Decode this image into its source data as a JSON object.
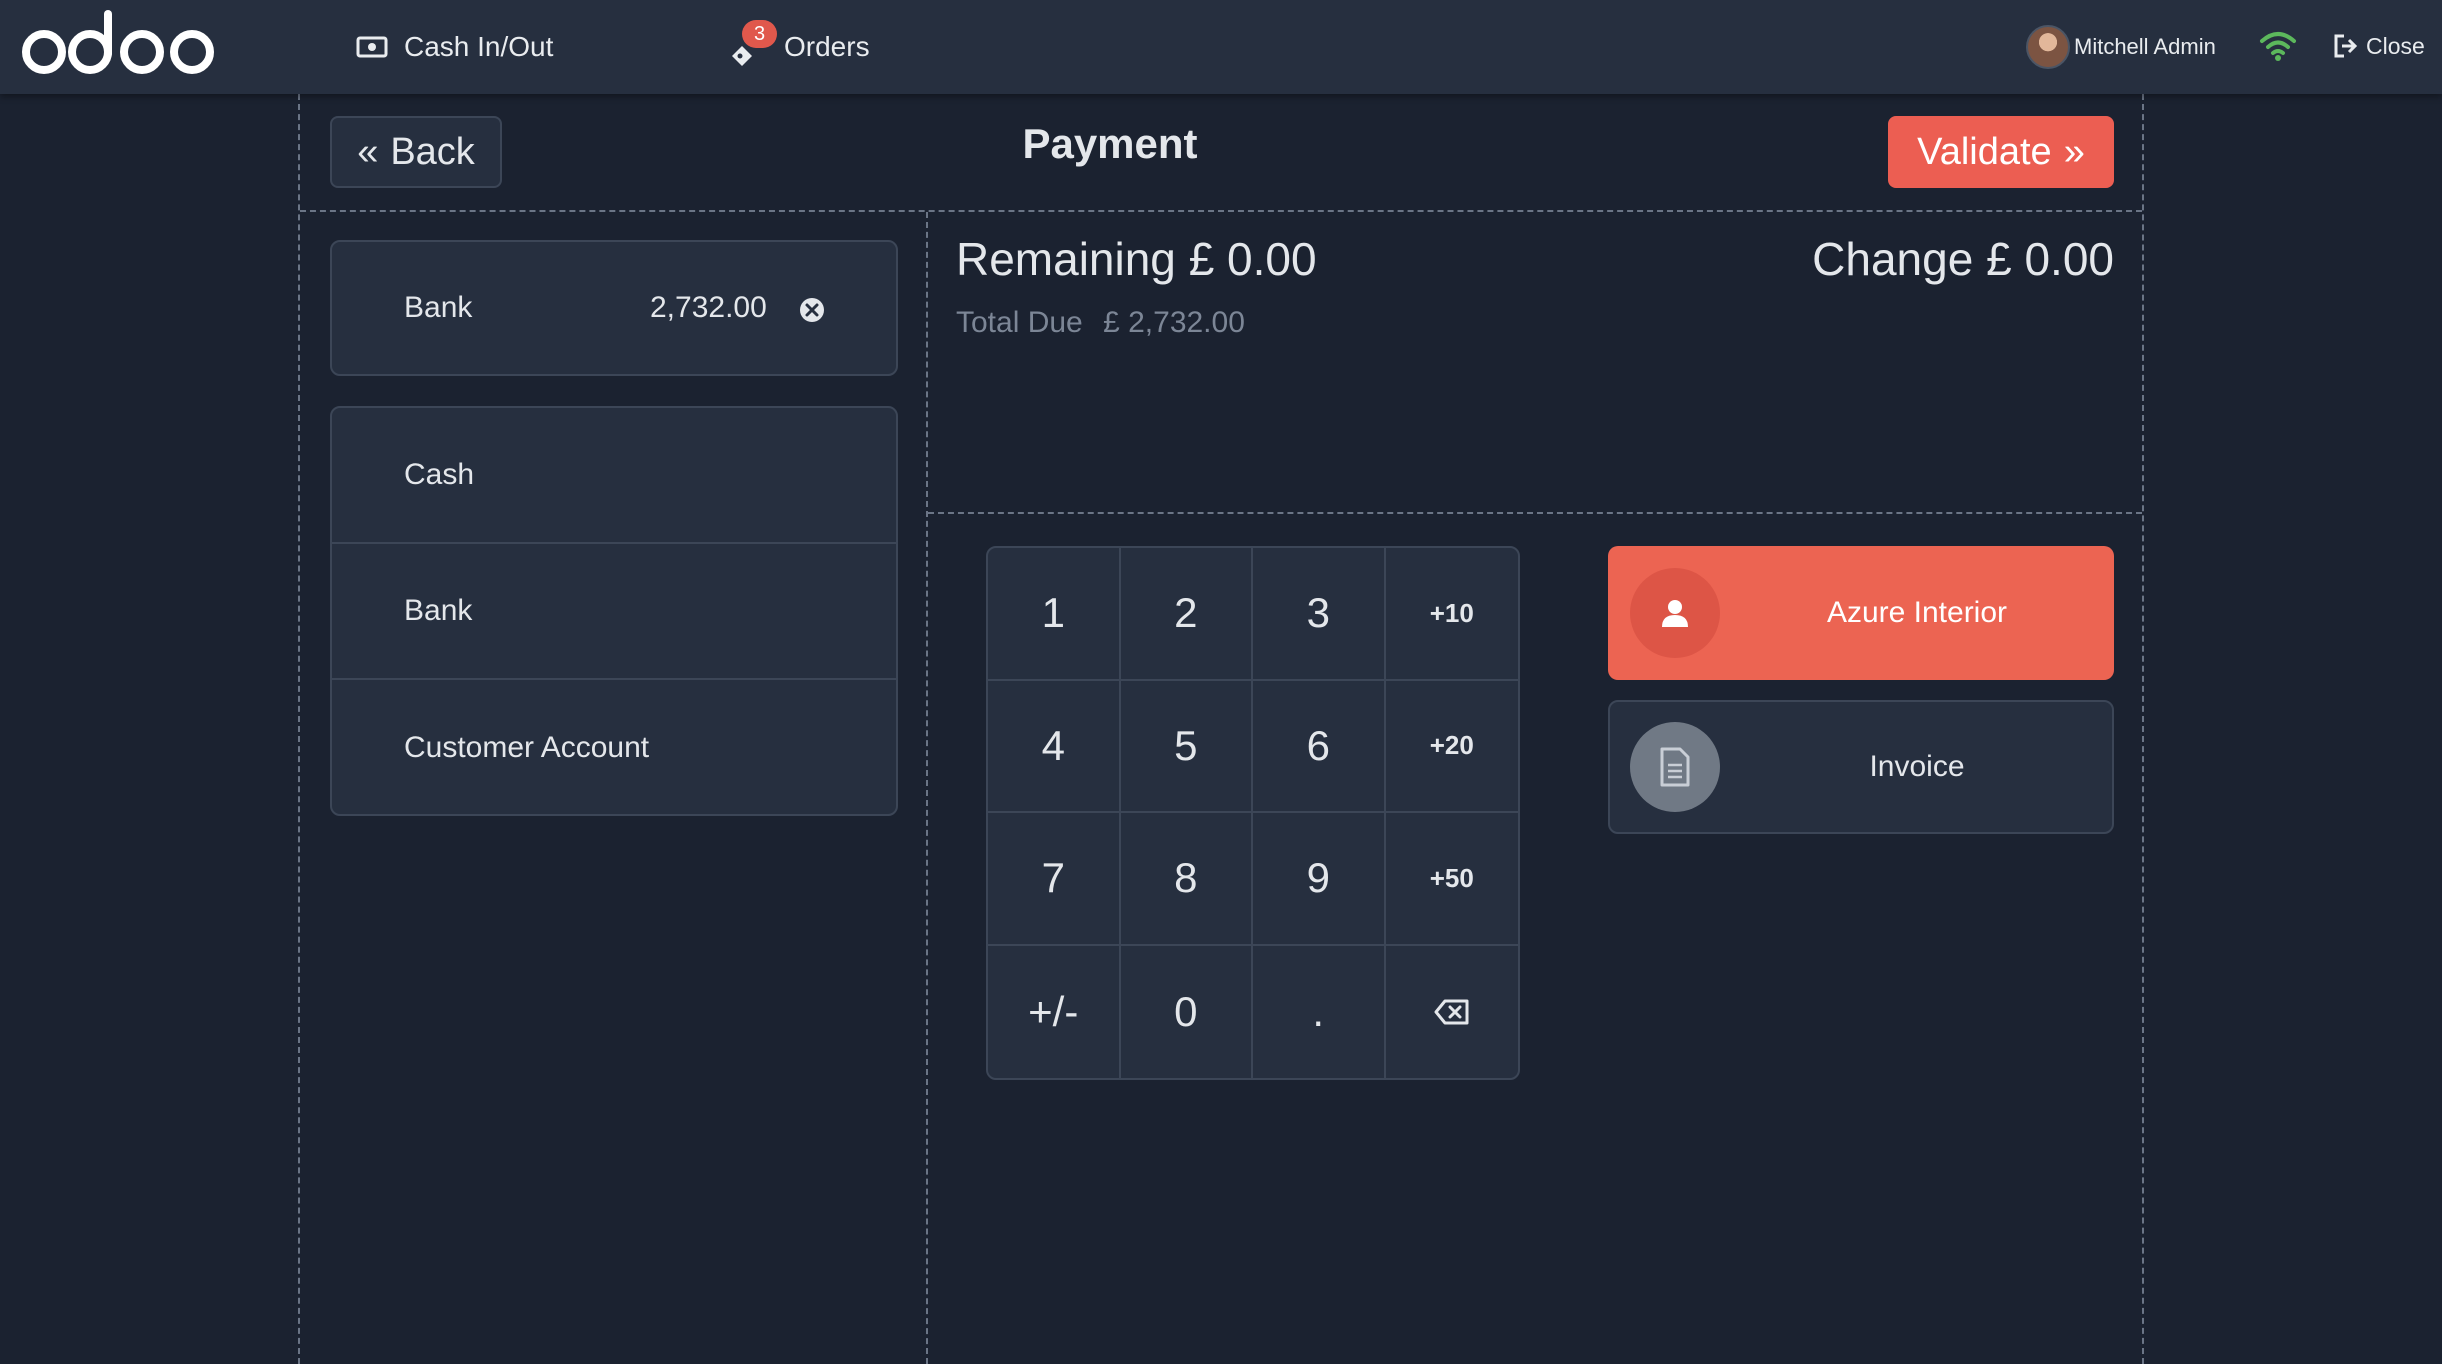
{
  "app": {
    "logo_text": "odoo"
  },
  "topbar": {
    "cash_in_out_label": "Cash In/Out",
    "orders_label": "Orders",
    "orders_count": "3",
    "user_name": "Mitchell Admin",
    "close_label": "Close",
    "connection_icon": "wifi-icon",
    "accent_color": "#ec5e52",
    "wifi_color": "#5cb85c"
  },
  "header": {
    "back_label": "Back",
    "title": "Payment",
    "validate_label": "Validate"
  },
  "paymentlines": [
    {
      "method": "Bank",
      "amount": "2,732.00"
    }
  ],
  "payment_methods": [
    {
      "label": "Cash"
    },
    {
      "label": "Bank"
    },
    {
      "label": "Customer Account"
    }
  ],
  "summary": {
    "remaining_label": "Remaining",
    "remaining_value": "£ 0.00",
    "change_label": "Change",
    "change_value": "£ 0.00",
    "total_due_label": "Total Due",
    "total_due_value": "£ 2,732.00"
  },
  "numpad": {
    "keys": [
      "1",
      "2",
      "3",
      "+10",
      "4",
      "5",
      "6",
      "+20",
      "7",
      "8",
      "9",
      "+50",
      "+/-",
      "0",
      "."
    ]
  },
  "customer": {
    "label": "Azure Interior"
  },
  "invoice": {
    "label": "Invoice"
  }
}
